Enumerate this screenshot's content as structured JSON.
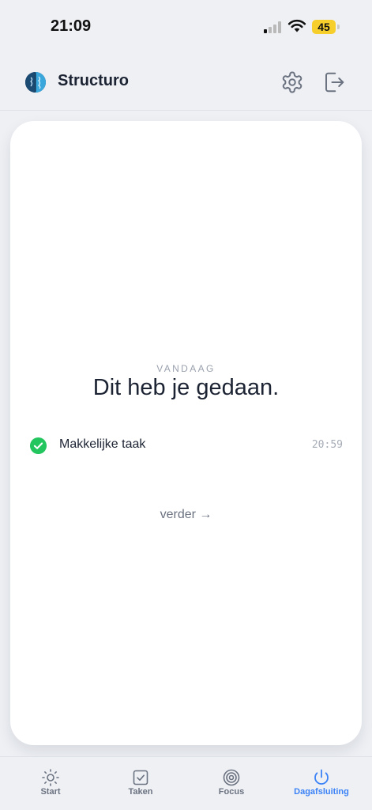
{
  "status_bar": {
    "time": "21:09",
    "battery": "45",
    "icons": [
      "signal-icon",
      "wifi-icon",
      "battery-icon"
    ]
  },
  "header": {
    "app_name": "Structuro",
    "logo_icon": "brain-logo-icon",
    "settings_icon": "gear-icon",
    "logout_icon": "logout-icon"
  },
  "summary": {
    "eyebrow": "VANDAAG",
    "title": "Dit heb je gedaan.",
    "tasks": [
      {
        "label": "Makkelijke taak",
        "time": "20:59",
        "status": "completed"
      }
    ],
    "next_label": "verder →"
  },
  "nav": {
    "active": "Dagafsluiting",
    "items": [
      {
        "label": "Start",
        "icon": "sun-icon"
      },
      {
        "label": "Taken",
        "icon": "checkbox-icon"
      },
      {
        "label": "Focus",
        "icon": "target-icon"
      },
      {
        "label": "Dagafsluiting",
        "icon": "power-icon"
      }
    ]
  },
  "colors": {
    "background": "#eef0f4",
    "card": "#ffffff",
    "text": "#1c2333",
    "accent": "#3b82f6",
    "success": "#22c55e",
    "battery": "#f7cf2c"
  }
}
